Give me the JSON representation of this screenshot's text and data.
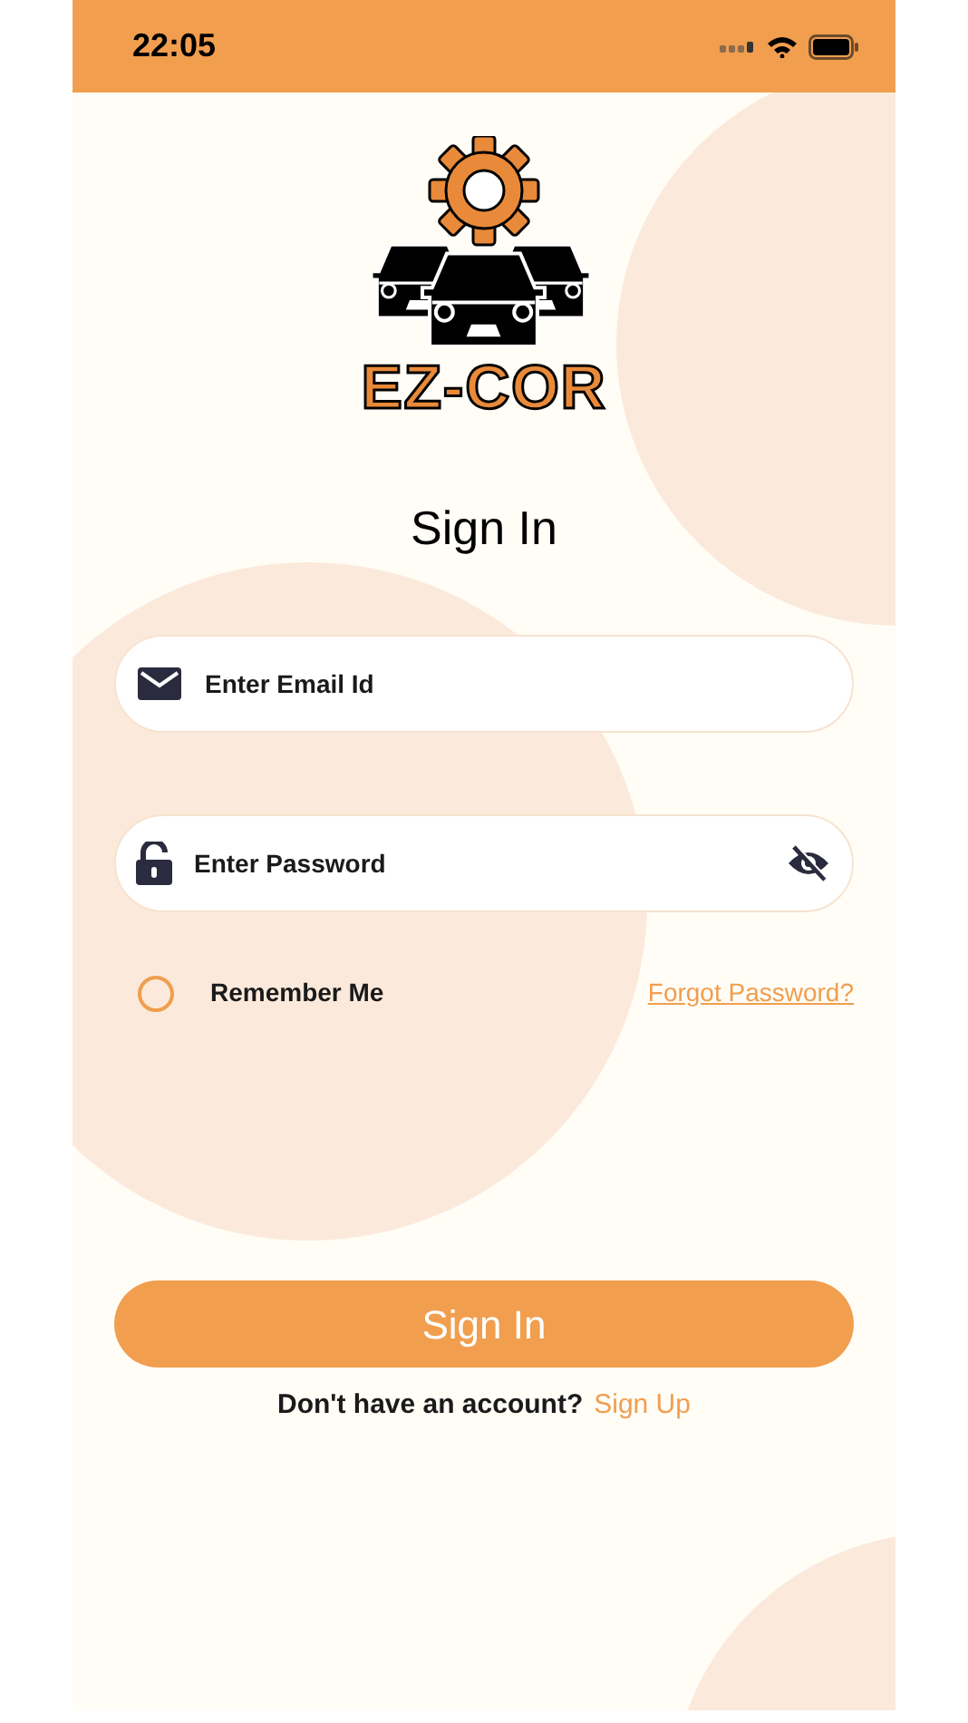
{
  "status_bar": {
    "time": "22:05"
  },
  "logo": {
    "text": "EZ-COR"
  },
  "title": "Sign In",
  "fields": [
    {
      "kind": "email",
      "placeholder": "Enter Email Id"
    },
    {
      "kind": "password",
      "placeholder": "Enter Password",
      "masked": true
    }
  ],
  "remember": {
    "label": "Remember Me",
    "checked": false
  },
  "forgot_link": "Forgot Password?",
  "sign_in_button": "Sign In",
  "signup_prompt": {
    "text": "Don't have an account?",
    "link": "Sign Up"
  }
}
